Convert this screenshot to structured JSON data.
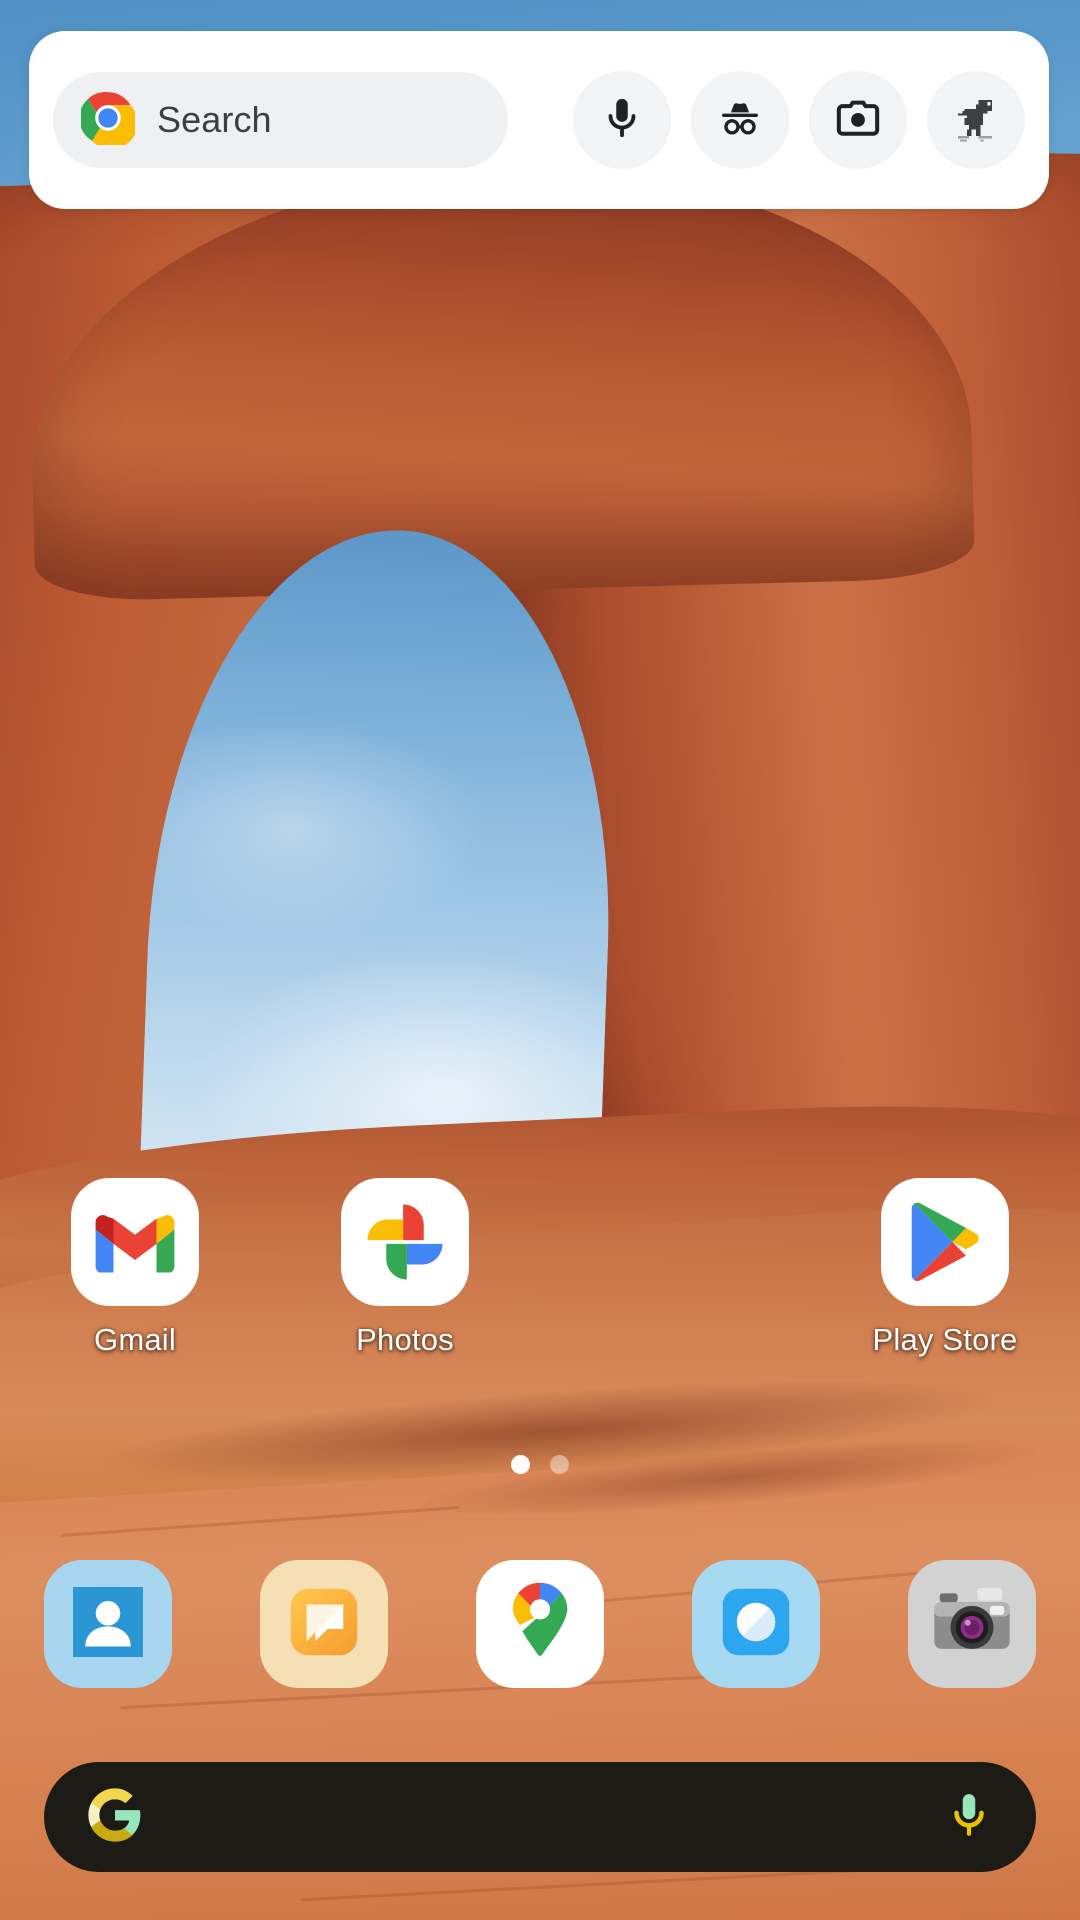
{
  "screen": {
    "name": "android-home-screen",
    "wallpaper_description": "Delicate Arch red sandstone rock formation against blue sky",
    "colors": {
      "widget_background": "#ffffff",
      "widget_pill": "#eef0f2",
      "widget_button": "#f1f3f4",
      "placeholder_text": "#3c4043",
      "label_text": "#ffffff",
      "bottom_bar_background": "#1d1b16",
      "bottom_bar_accent_yellow": "#e8c300",
      "bottom_bar_accent_mint": "#97e6bc",
      "sky_blue": "#7fb0dc",
      "rock_red": "#b75831",
      "sand_orange": "#d98253"
    }
  },
  "search_widget": {
    "name": "chrome-search-widget",
    "placeholder": "Search",
    "logo_icon": "chrome-icon",
    "buttons": [
      {
        "name": "voice-search-button",
        "icon": "microphone-icon",
        "label": "Voice search"
      },
      {
        "name": "incognito-button",
        "icon": "incognito-icon",
        "label": "Incognito"
      },
      {
        "name": "lens-button",
        "icon": "camera-icon",
        "label": "Google Lens"
      },
      {
        "name": "dino-game-button",
        "icon": "dinosaur-icon",
        "label": "Dino game"
      }
    ]
  },
  "app_grid": {
    "name": "home-screen-app-grid",
    "apps": [
      {
        "label": "Gmail",
        "icon": "gmail-icon",
        "slot": 1
      },
      {
        "label": "Photos",
        "icon": "photos-icon",
        "slot": 2
      },
      {
        "label": "",
        "icon": "empty",
        "slot": 3
      },
      {
        "label": "Play Store",
        "icon": "playstore-icon",
        "slot": 4
      }
    ]
  },
  "page_indicator": {
    "name": "page-indicator",
    "total_pages": 2,
    "current_page": 1,
    "dots": [
      {
        "state": "active"
      },
      {
        "state": "inactive"
      }
    ]
  },
  "dock": {
    "name": "home-screen-dock",
    "apps": [
      {
        "label": "Contacts",
        "icon": "contacts-icon"
      },
      {
        "label": "Messages",
        "icon": "messages-icon"
      },
      {
        "label": "Maps",
        "icon": "maps-icon"
      },
      {
        "label": "Browser",
        "icon": "browser-icon"
      },
      {
        "label": "Camera",
        "icon": "camera-app-icon"
      }
    ]
  },
  "bottom_search_bar": {
    "name": "google-search-bar",
    "text": "",
    "logo_icon": "google-g-icon",
    "mic_icon": "microphone-icon"
  }
}
